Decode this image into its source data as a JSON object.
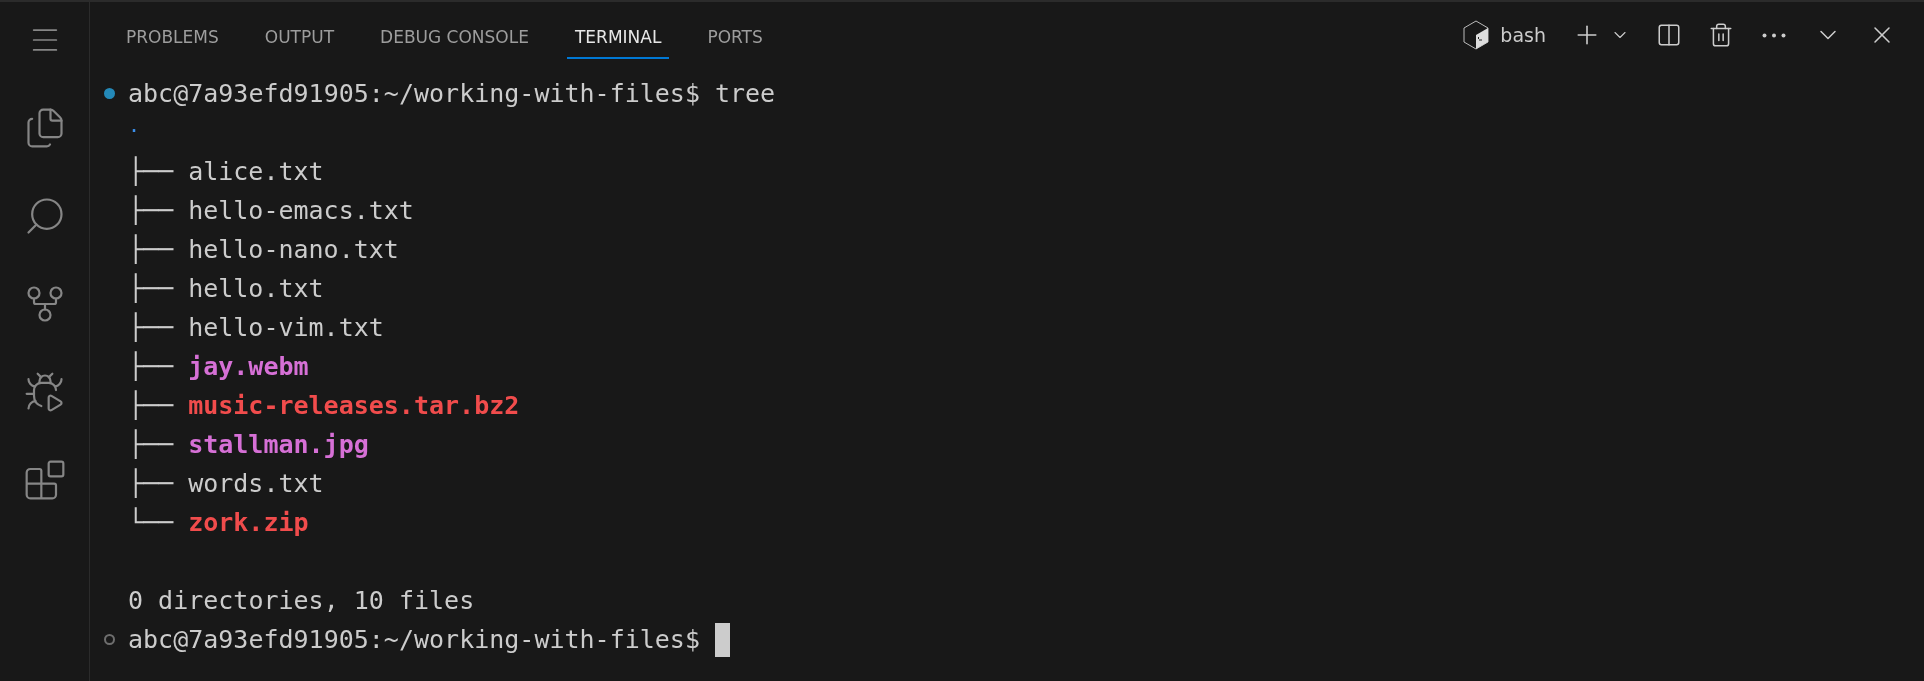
{
  "activity_bar": {
    "items": [
      {
        "kind": "menu",
        "selected": false
      },
      {
        "kind": "explorer",
        "selected": false
      },
      {
        "kind": "search",
        "selected": false
      },
      {
        "kind": "source-control",
        "selected": false
      },
      {
        "kind": "run-debug",
        "selected": false
      },
      {
        "kind": "extensions",
        "selected": false
      }
    ]
  },
  "panel_tabs": [
    {
      "label": "PROBLEMS",
      "selected": false
    },
    {
      "label": "OUTPUT",
      "selected": false
    },
    {
      "label": "DEBUG CONSOLE",
      "selected": false
    },
    {
      "label": "TERMINAL",
      "selected": true
    },
    {
      "label": "PORTS",
      "selected": false
    }
  ],
  "terminal_toolbar": {
    "shell": "bash"
  },
  "terminal": {
    "lines": [
      {
        "kind": "prompt",
        "succeeded": true,
        "prompt": "abc@7a93efd91905:~/working-with-files$",
        "command": "tree"
      },
      {
        "kind": "root",
        "text": ".",
        "color": "#3b8eea"
      },
      {
        "kind": "entry",
        "branch": "├──",
        "name": "alice.txt",
        "bold": false,
        "color": "#cccccc"
      },
      {
        "kind": "entry",
        "branch": "├──",
        "name": "hello-emacs.txt",
        "bold": false,
        "color": "#cccccc"
      },
      {
        "kind": "entry",
        "branch": "├──",
        "name": "hello-nano.txt",
        "bold": false,
        "color": "#cccccc"
      },
      {
        "kind": "entry",
        "branch": "├──",
        "name": "hello.txt",
        "bold": false,
        "color": "#cccccc"
      },
      {
        "kind": "entry",
        "branch": "├──",
        "name": "hello-vim.txt",
        "bold": false,
        "color": "#cccccc"
      },
      {
        "kind": "entry",
        "branch": "├──",
        "name": "jay.webm",
        "bold": true,
        "color": "#d670d6"
      },
      {
        "kind": "entry",
        "branch": "├──",
        "name": "music-releases.tar.bz2",
        "bold": true,
        "color": "#f14c4c"
      },
      {
        "kind": "entry",
        "branch": "├──",
        "name": "stallman.jpg",
        "bold": true,
        "color": "#d670d6"
      },
      {
        "kind": "entry",
        "branch": "├──",
        "name": "words.txt",
        "bold": false,
        "color": "#cccccc"
      },
      {
        "kind": "entry",
        "branch": "└──",
        "name": "zork.zip",
        "bold": true,
        "color": "#f14c4c"
      },
      {
        "kind": "blank"
      },
      {
        "kind": "output",
        "text": "0 directories, 10 files"
      },
      {
        "kind": "prompt",
        "succeeded": false,
        "prompt": "abc@7a93efd91905:~/working-with-files$",
        "cursor": true
      }
    ]
  }
}
